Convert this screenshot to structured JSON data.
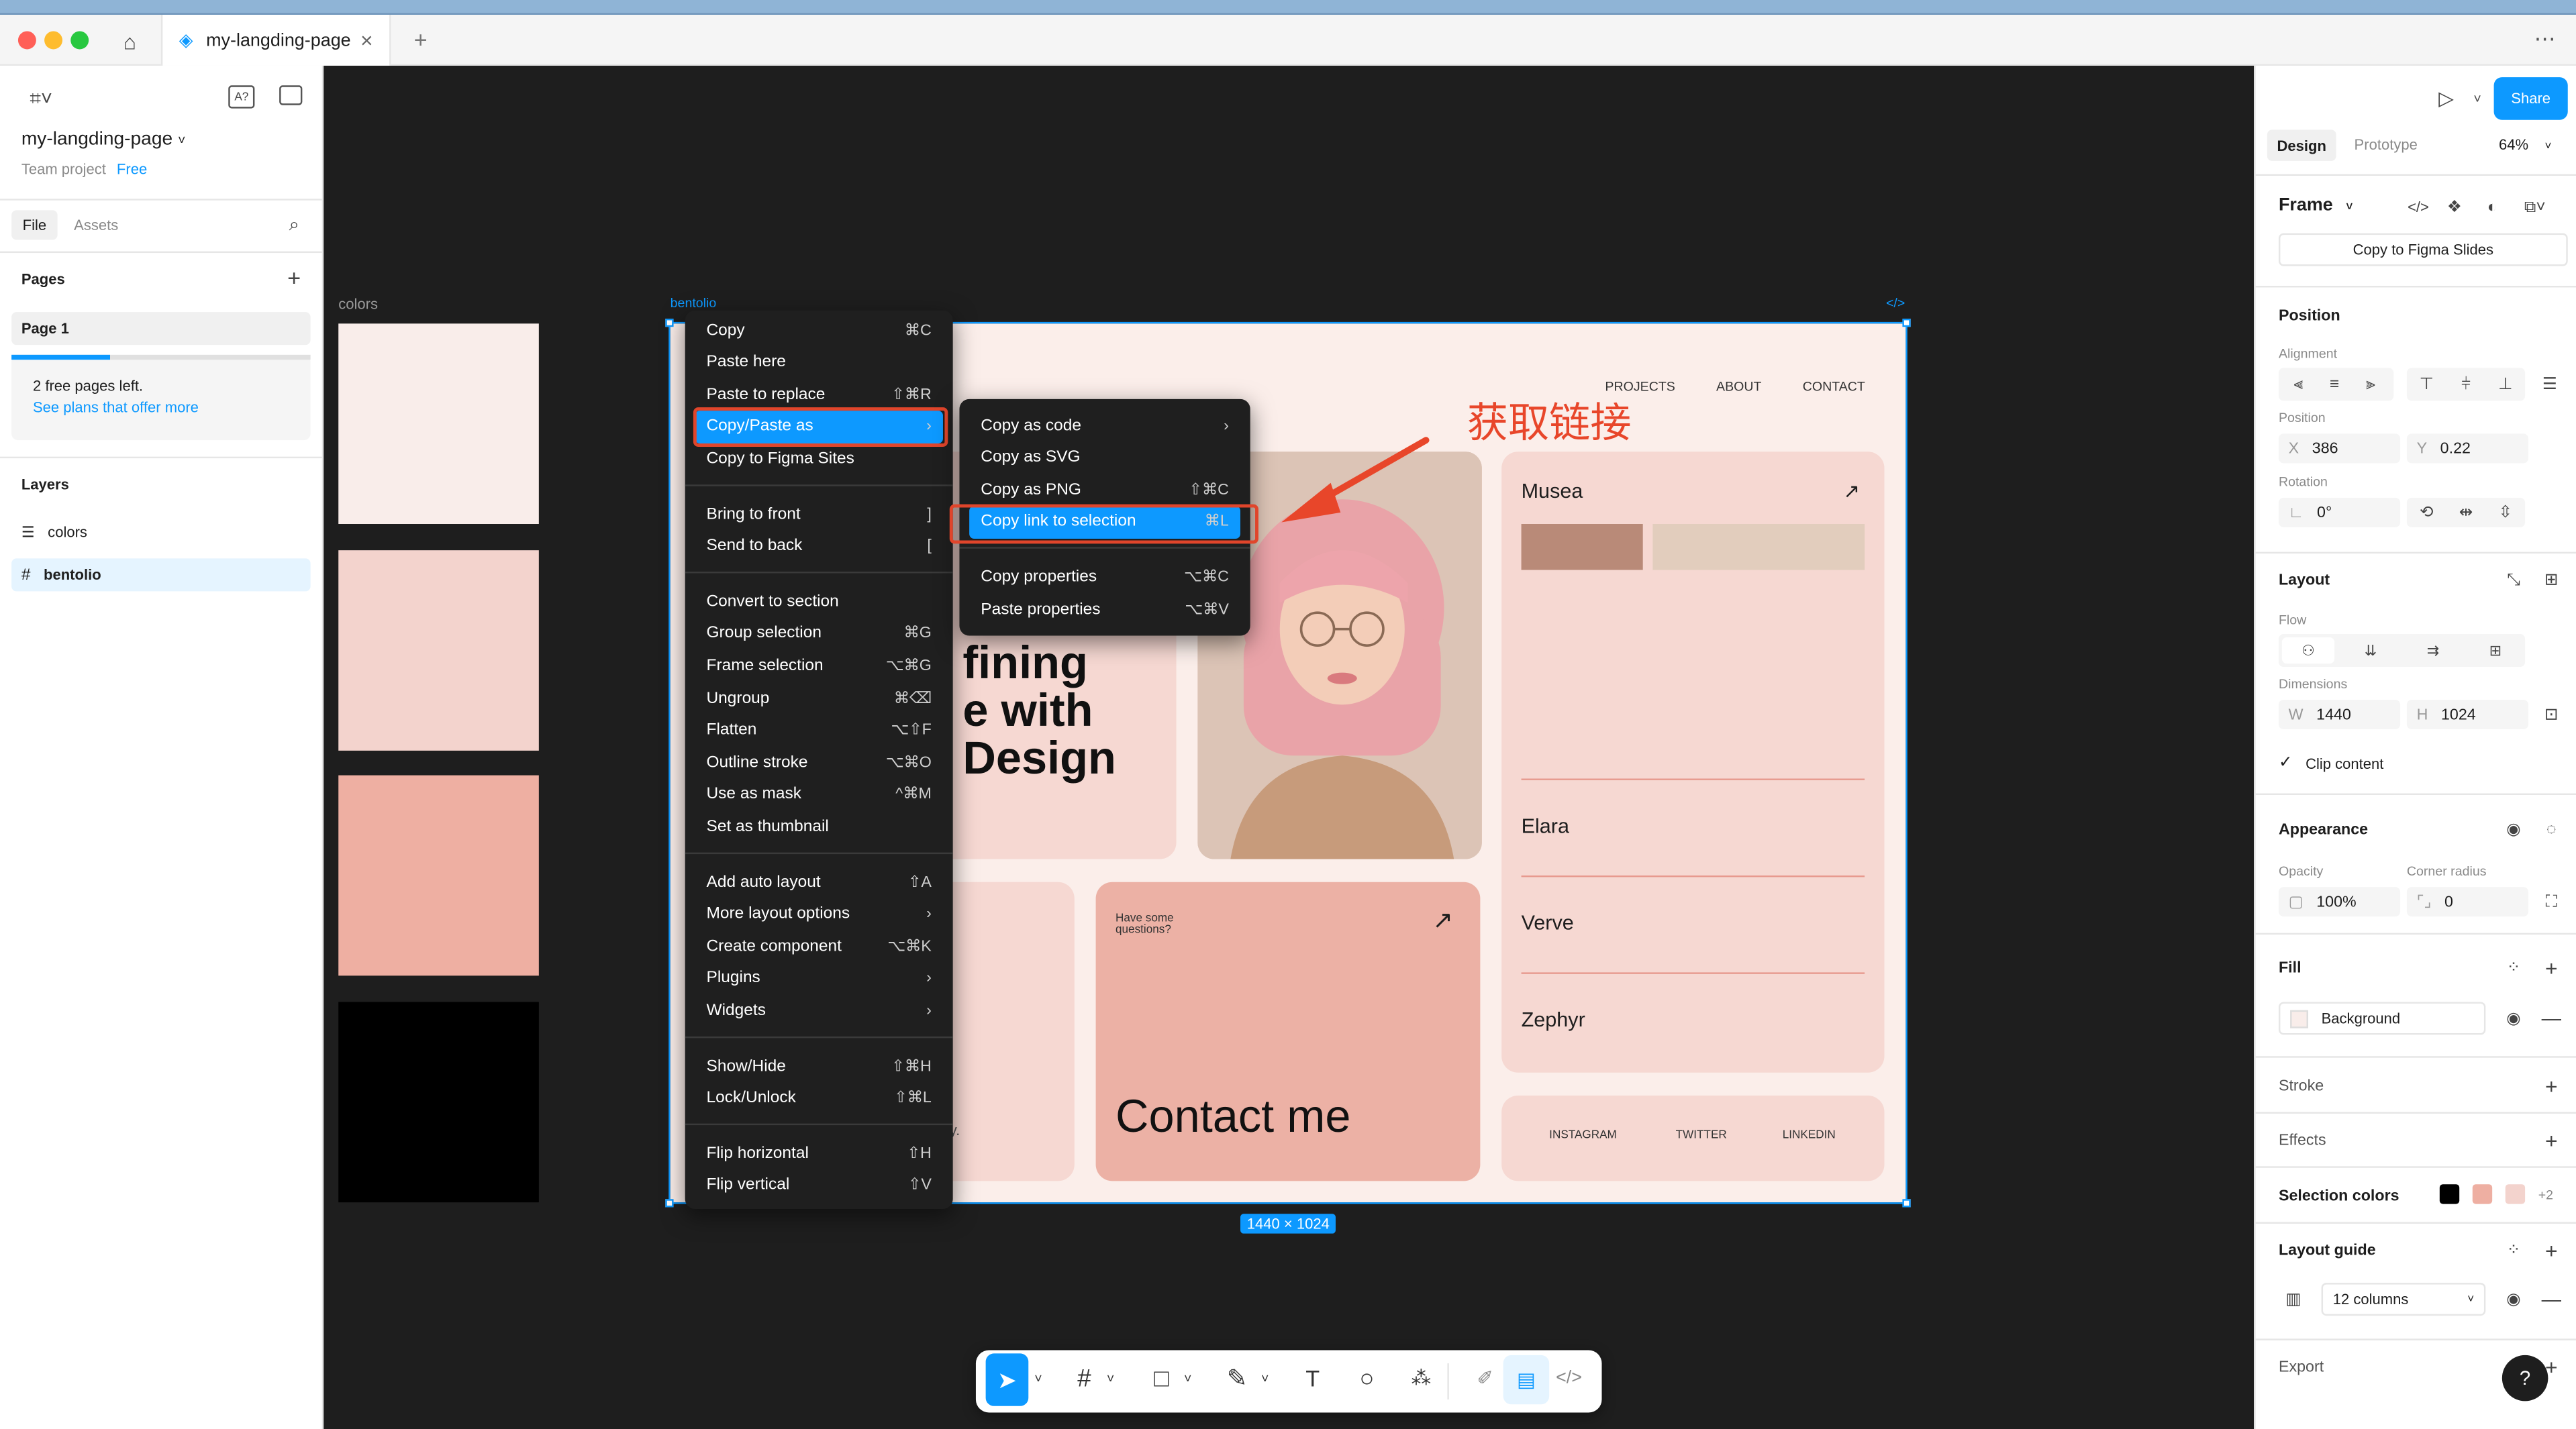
{
  "tab": {
    "title": "my-langding-page"
  },
  "left": {
    "file_name": "my-langding-page",
    "team": "Team project",
    "plan": "Free",
    "tabs": [
      "File",
      "Assets"
    ],
    "pages_heading": "Pages",
    "page": "Page 1",
    "pages_left": "2 free pages left.",
    "plans_link": "See plans that offer more",
    "layers_heading": "Layers",
    "layers": [
      {
        "name": "colors",
        "icon": "list-icon"
      },
      {
        "name": "bentolio",
        "icon": "frame-hash-icon"
      }
    ]
  },
  "canvas": {
    "colors_label": "colors",
    "frame_label": "bentolio",
    "frame_size": "1440 × 1024",
    "swatches": [
      "#f9edea",
      "#f3d3cd",
      "#eeafa2",
      "#000000"
    ],
    "annotation": "获取链接",
    "site": {
      "nav": [
        "PROJECTS",
        "ABOUT",
        "CONTACT"
      ],
      "hero_lines": [
        "fining",
        "e with",
        "Design"
      ],
      "projects": [
        "Musea",
        "Elara",
        "Verve",
        "Zephyr"
      ],
      "question": "Have some questions?",
      "contact": "Contact me",
      "socials": [
        "INSTAGRAM",
        "TWITTER",
        "LINKEDIN"
      ],
      "stub_text": "y."
    }
  },
  "context_menu": {
    "groups": [
      [
        {
          "label": "Copy",
          "shortcut": "⌘C"
        },
        {
          "label": "Paste here",
          "shortcut": ""
        },
        {
          "label": "Paste to replace",
          "shortcut": "⇧⌘R"
        },
        {
          "label": "Copy/Paste as",
          "shortcut": "›"
        },
        {
          "label": "Copy to Figma Sites",
          "shortcut": ""
        }
      ],
      [
        {
          "label": "Bring to front",
          "shortcut": "]"
        },
        {
          "label": "Send to back",
          "shortcut": "["
        }
      ],
      [
        {
          "label": "Convert to section",
          "shortcut": ""
        },
        {
          "label": "Group selection",
          "shortcut": "⌘G"
        },
        {
          "label": "Frame selection",
          "shortcut": "⌥⌘G"
        },
        {
          "label": "Ungroup",
          "shortcut": "⌘⌫"
        },
        {
          "label": "Flatten",
          "shortcut": "⌥⇧F"
        },
        {
          "label": "Outline stroke",
          "shortcut": "⌥⌘O"
        },
        {
          "label": "Use as mask",
          "shortcut": "^⌘M"
        },
        {
          "label": "Set as thumbnail",
          "shortcut": ""
        }
      ],
      [
        {
          "label": "Add auto layout",
          "shortcut": "⇧A"
        },
        {
          "label": "More layout options",
          "shortcut": "›"
        },
        {
          "label": "Create component",
          "shortcut": "⌥⌘K"
        },
        {
          "label": "Plugins",
          "shortcut": "›"
        },
        {
          "label": "Widgets",
          "shortcut": "›"
        }
      ],
      [
        {
          "label": "Show/Hide",
          "shortcut": "⇧⌘H"
        },
        {
          "label": "Lock/Unlock",
          "shortcut": "⇧⌘L"
        }
      ],
      [
        {
          "label": "Flip horizontal",
          "shortcut": "⇧H"
        },
        {
          "label": "Flip vertical",
          "shortcut": "⇧V"
        }
      ]
    ]
  },
  "submenu": {
    "groups": [
      [
        {
          "label": "Copy as code",
          "shortcut": "›"
        },
        {
          "label": "Copy as SVG",
          "shortcut": ""
        },
        {
          "label": "Copy as PNG",
          "shortcut": "⇧⌘C"
        },
        {
          "label": "Copy link to selection",
          "shortcut": "⌘L"
        }
      ],
      [
        {
          "label": "Copy properties",
          "shortcut": "⌥⌘C"
        },
        {
          "label": "Paste properties",
          "shortcut": "⌥⌘V"
        }
      ]
    ]
  },
  "right": {
    "share": "Share",
    "tabs": [
      "Design",
      "Prototype"
    ],
    "zoom": "64%",
    "frame": "Frame",
    "copy_slides": "Copy to Figma Slides",
    "position": "Position",
    "alignment": "Alignment",
    "position_label": "Position",
    "x": "386",
    "y": "0.22",
    "rotation_label": "Rotation",
    "rotation": "0°",
    "layout": "Layout",
    "flow": "Flow",
    "dimensions": "Dimensions",
    "w": "1440",
    "h": "1024",
    "clip": "Clip content",
    "appearance": "Appearance",
    "opacity_label": "Opacity",
    "radius_label": "Corner radius",
    "opacity": "100%",
    "radius": "0",
    "fill": "Fill",
    "fill_name": "Background",
    "stroke": "Stroke",
    "effects": "Effects",
    "selection_colors": "Selection colors",
    "sel_more": "+2",
    "sel_colors": [
      "#000000",
      "#eeafa2",
      "#f3d3cd"
    ],
    "layout_guide": "Layout guide",
    "columns": "12 columns",
    "export": "Export",
    "help": "?"
  }
}
